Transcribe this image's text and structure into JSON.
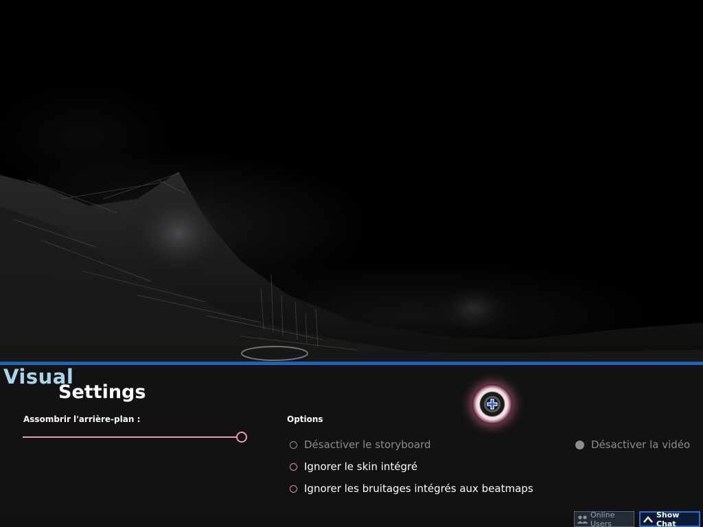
{
  "header": {
    "title_word1": "Visual",
    "title_word2": "Settings"
  },
  "background_dim": {
    "label": "Assombrir l'arrière-plan :",
    "value_fraction": 1.0
  },
  "options": {
    "label": "Options",
    "items": [
      {
        "label": "Désactiver le storyboard",
        "state": "disabled"
      },
      {
        "label": "Ignorer le skin intégré",
        "state": "enabled"
      },
      {
        "label": "Ignorer les bruitages intégrés aux beatmaps",
        "state": "enabled"
      },
      {
        "label": "Désactiver la vidéo",
        "state": "disabled-filled"
      }
    ]
  },
  "footer": {
    "online_users": "Online Users",
    "show_chat": "Show Chat"
  },
  "colors": {
    "accent_blue": "#1f63b4",
    "title_visual": "#a9d4ea",
    "slider_pink": "#e8a0ae",
    "disabled_gray": "#8d8d8d"
  },
  "icons": {
    "cursor": "osu-cursor-icon",
    "online_users": "users-icon",
    "show_chat": "chevron-up-icon"
  }
}
